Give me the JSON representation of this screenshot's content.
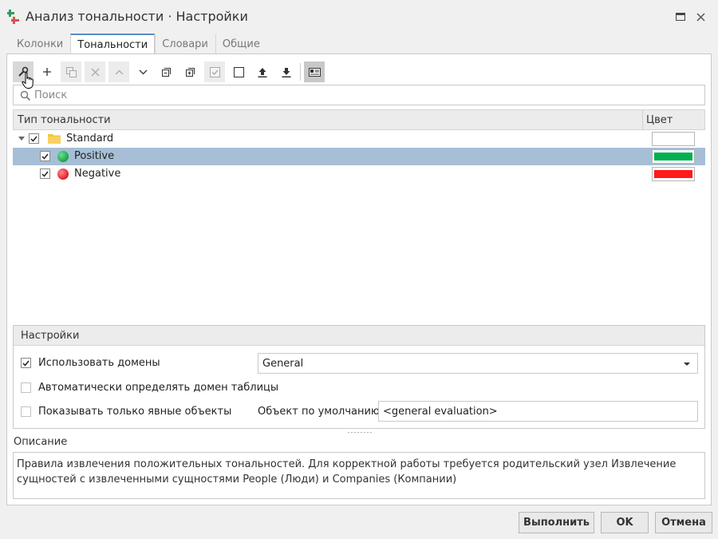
{
  "window": {
    "title": "Анализ тональности · Настройки",
    "icon": "sentiment-app-icon"
  },
  "tabs": [
    {
      "label": "Колонки",
      "active": false
    },
    {
      "label": "Тональности",
      "active": true
    },
    {
      "label": "Словари",
      "active": false
    },
    {
      "label": "Общие",
      "active": false
    }
  ],
  "toolbar": {
    "buttons": [
      {
        "icon": "wrench-icon",
        "state": "hover"
      },
      {
        "icon": "plus-icon",
        "state": "enabled"
      },
      {
        "icon": "copy-icon",
        "state": "disabled"
      },
      {
        "icon": "delete-x-icon",
        "state": "disabled"
      },
      {
        "icon": "chevron-up-icon",
        "state": "disabled"
      },
      {
        "icon": "chevron-down-icon",
        "state": "enabled"
      },
      {
        "icon": "collapse-all-icon",
        "state": "enabled"
      },
      {
        "icon": "expand-all-icon",
        "state": "enabled"
      },
      {
        "icon": "check-all-icon",
        "state": "disabled"
      },
      {
        "icon": "uncheck-all-icon",
        "state": "enabled"
      },
      {
        "icon": "upload-icon",
        "state": "enabled"
      },
      {
        "icon": "download-icon",
        "state": "enabled"
      },
      {
        "icon": "view-toggle-icon",
        "state": "pressed"
      }
    ]
  },
  "search": {
    "placeholder": "Поиск",
    "value": ""
  },
  "grid": {
    "columns": [
      "Тип тональности",
      "Цвет"
    ],
    "rows": [
      {
        "label": "Standard",
        "level": 0,
        "checked": true,
        "expanded": true,
        "icon": "folder-icon",
        "color": "#ffffff",
        "selected": false
      },
      {
        "label": "Positive",
        "level": 1,
        "checked": true,
        "icon": "green-dot-icon",
        "color": "#00b050",
        "selected": true
      },
      {
        "label": "Negative",
        "level": 1,
        "checked": true,
        "icon": "red-dot-icon",
        "color": "#ff1a1a",
        "selected": false
      }
    ]
  },
  "settings": {
    "title": "Настройки",
    "use_domains": {
      "label": "Использовать домены",
      "checked": true
    },
    "domain_combo": {
      "value": "General"
    },
    "auto_domain": {
      "label": "Автоматически определять домен таблицы",
      "checked": false
    },
    "explicit_only": {
      "label": "Показывать только явные объекты",
      "checked": false
    },
    "default_object": {
      "label": "Объект по умолчанию",
      "value": "<general evaluation>"
    }
  },
  "description": {
    "label": "Описание",
    "text": "Правила извлечения положительных тональностей. Для корректной работы требуется родительский узел Извлечение сущностей с извлеченными сущностями People (Люди) и Companies (Компании)"
  },
  "buttons": {
    "run": "Выполнить",
    "ok": "OK",
    "cancel": "Отмена"
  },
  "colors": {
    "selection": "#a6bfd6",
    "tab_accent": "#5a8ec4",
    "positive": "#00b050",
    "negative": "#ff1a1a"
  }
}
